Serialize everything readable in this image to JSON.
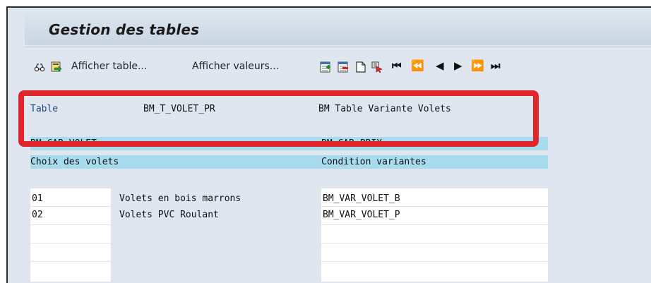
{
  "title": "Gestion des tables",
  "toolbar": {
    "icons": [
      "glasses-icon",
      "export-icon"
    ],
    "afficher_table": "Afficher table...",
    "afficher_valeurs": "Afficher valeurs...",
    "record_icons": [
      "add-row-icon",
      "delete-row-icon",
      "new-page-icon",
      "select-cursor-icon"
    ],
    "nav": {
      "first": "⏮",
      "prev_page": "⏪",
      "prev": "◀",
      "next": "▶",
      "next_page": "⏩",
      "last": "⏭"
    }
  },
  "table_info": {
    "label": "Table",
    "name": "BM_T_VOLET_PR",
    "description": "BM Table Variante Volets"
  },
  "columns": {
    "col1_field": "BM CAR VOLET",
    "col2_field": "BM CAR PRIX",
    "col1_title": "Choix des volets",
    "col2_title": "Condition variantes"
  },
  "rows": [
    {
      "code": "01",
      "label": "Volets en bois marrons",
      "value": "BM_VAR_VOLET_B"
    },
    {
      "code": "02",
      "label": "Volets PVC Roulant",
      "value": "BM_VAR_VOLET_P"
    }
  ],
  "colors": {
    "highlight": "#e0262c",
    "header_band": "#a6dcee",
    "field_label": "#1f3f86"
  }
}
